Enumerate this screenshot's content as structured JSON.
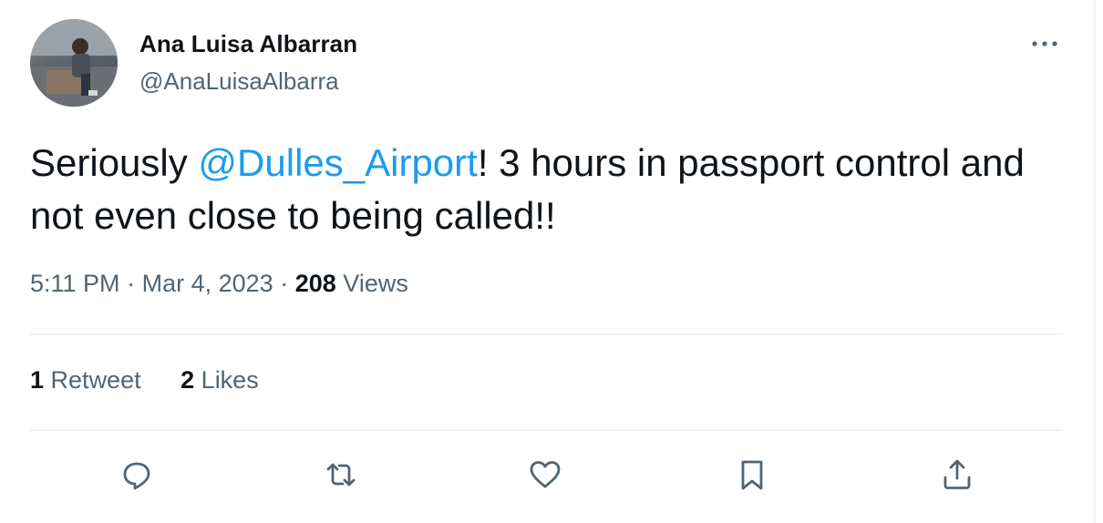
{
  "author": {
    "display_name": "Ana Luisa Albarran",
    "handle": "@AnaLuisaAlbarra",
    "avatar_icon": "profile-photo"
  },
  "tweet": {
    "text_before": "Seriously ",
    "mention": "@Dulles_Airport",
    "text_after": "! 3 hours in passport control and not even close to being called!!",
    "mention_color": "#1d9bf0"
  },
  "meta": {
    "time": "5:11 PM",
    "separator": "·",
    "date": "Mar 4, 2023",
    "views_count": "208",
    "views_label": "Views"
  },
  "stats": {
    "retweets_count": "1",
    "retweets_label": "Retweet",
    "likes_count": "2",
    "likes_label": "Likes"
  },
  "actions": [
    {
      "icon": "reply-icon"
    },
    {
      "icon": "retweet-icon"
    },
    {
      "icon": "like-icon"
    },
    {
      "icon": "bookmark-icon"
    },
    {
      "icon": "share-icon"
    }
  ],
  "more_icon": "more-options-icon"
}
